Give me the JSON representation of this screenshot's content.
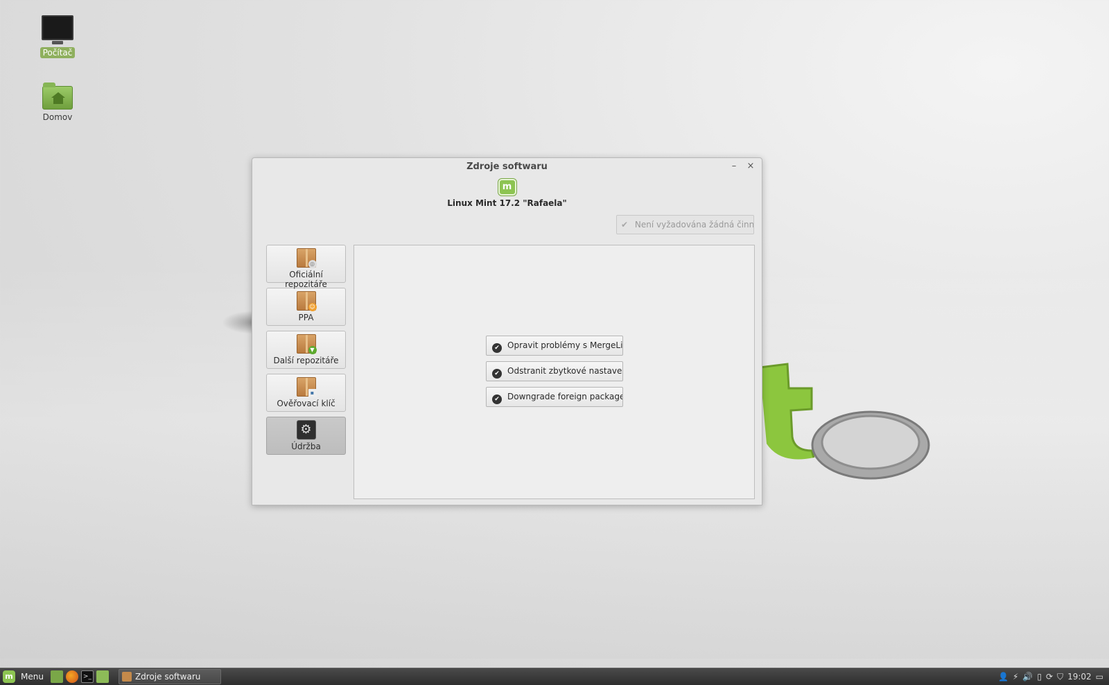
{
  "desktop": {
    "icons": [
      {
        "label": "Počítač",
        "icon": "computer-monitor-icon",
        "selected": true
      },
      {
        "label": "Domov",
        "icon": "home-folder-icon",
        "selected": false
      }
    ]
  },
  "window": {
    "title": "Zdroje softwaru",
    "minimize_glyph": "–",
    "close_glyph": "×",
    "header": {
      "logo_text": "m",
      "distro": "Linux Mint 17.2 \"Rafaela\""
    },
    "status_button": {
      "check": "✔",
      "label": "Není vyžadována žádná činnost"
    },
    "sidebar": [
      {
        "label": "Oficiální repozitáře",
        "icon": "package-cd-icon"
      },
      {
        "label": "PPA",
        "icon": "package-ppa-icon"
      },
      {
        "label": "Další repozitáře",
        "icon": "package-add-icon"
      },
      {
        "label": "Ověřovací klíč",
        "icon": "package-key-icon"
      },
      {
        "label": "Údržba",
        "icon": "tools-icon",
        "active": true
      }
    ],
    "maintenance_buttons": [
      {
        "label": "Opravit problémy s MergeList"
      },
      {
        "label": "Odstranit zbytkové nastavení"
      },
      {
        "label": "Downgrade foreign packages"
      }
    ],
    "check_glyph": "✔"
  },
  "taskbar": {
    "menu_label": "Menu",
    "menu_logo": "m",
    "terminal_glyph": ">_",
    "task_label": "Zdroje softwaru",
    "tray_icons": [
      "user-icon",
      "network-icon",
      "volume-icon",
      "battery-icon",
      "update-icon",
      "shield-icon",
      "display-icon"
    ],
    "tray_glyphs": [
      "👤",
      "⚡",
      "🔊",
      "▯",
      "⟳",
      "⛉",
      "▭"
    ],
    "clock": "19:02"
  },
  "colors": {
    "mint_green": "#8dc452",
    "selected_label_bg": "#8fb05e",
    "taskbar": "#3a3a3a"
  }
}
